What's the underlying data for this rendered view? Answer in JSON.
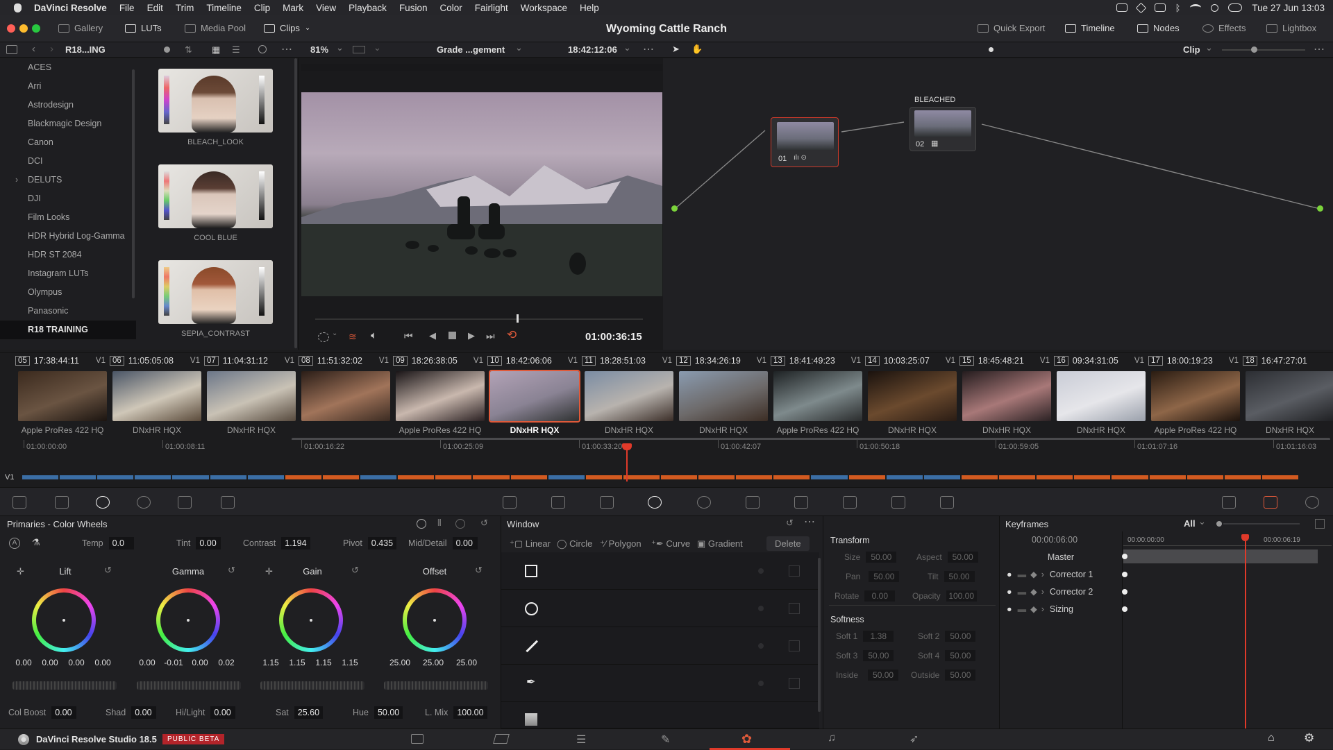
{
  "menubar": {
    "apple": "",
    "app_name": "DaVinci Resolve",
    "items": [
      "File",
      "Edit",
      "Trim",
      "Timeline",
      "Clip",
      "Mark",
      "View",
      "Playback",
      "Fusion",
      "Color",
      "Fairlight",
      "Workspace",
      "Help"
    ],
    "datetime": "Tue 27 Jun  13:03"
  },
  "titlebar": {
    "gallery": "Gallery",
    "luts": "LUTs",
    "media_pool": "Media Pool",
    "clips": "Clips",
    "project_title": "Wyoming Cattle Ranch",
    "quick_export": "Quick Export",
    "timeline": "Timeline",
    "nodes": "Nodes",
    "effects": "Effects",
    "lightbox": "Lightbox"
  },
  "toolbar2": {
    "folder": "R18...ING",
    "zoom": "81%",
    "grade_name": "Grade ...gement",
    "timecode": "18:42:12:06",
    "clip_mode": "Clip"
  },
  "lut_folders": [
    "ACES",
    "Arri",
    "Astrodesign",
    "Blackmagic Design",
    "Canon",
    "DCI",
    "DELUTS",
    "DJI",
    "Film Looks",
    "HDR Hybrid Log-Gamma",
    "HDR ST 2084",
    "Instagram LUTs",
    "Olympus",
    "Panasonic",
    "R18 TRAINING"
  ],
  "lut_thumbs": [
    "BLEACH_LOOK",
    "COOL BLUE",
    "SEPIA_CONTRAST"
  ],
  "viewer": {
    "timecode": "01:00:36:15"
  },
  "nodes": {
    "node1_label": "01",
    "node2_title": "BLEACHED",
    "node2_label": "02"
  },
  "clips": [
    {
      "num": "05",
      "tc": "17:38:44:11",
      "track": "V1",
      "codec": "Apple ProRes 422 HQ",
      "colors": [
        "#3b2a1e",
        "#6a5442",
        "#1b1410"
      ]
    },
    {
      "num": "06",
      "tc": "11:05:05:08",
      "track": "V1",
      "codec": "DNxHR HQX",
      "colors": [
        "#4a5566",
        "#cfc7b8",
        "#5a4a3a"
      ]
    },
    {
      "num": "07",
      "tc": "11:04:31:12",
      "track": "V1",
      "codec": "DNxHR HQX",
      "colors": [
        "#6b7688",
        "#c9c2b5",
        "#56493d"
      ]
    },
    {
      "num": "08",
      "tc": "11:51:32:02",
      "track": "V1",
      "codec": "",
      "colors": [
        "#2a1d17",
        "#a1745a",
        "#3b2b22"
      ]
    },
    {
      "num": "09",
      "tc": "18:26:38:05",
      "track": "V1",
      "codec": "Apple ProRes 422 HQ",
      "colors": [
        "#1a1517",
        "#c9b8ae",
        "#2a2022"
      ]
    },
    {
      "num": "10",
      "tc": "18:42:06:06",
      "track": "V1",
      "codec": "DNxHR HQX",
      "colors": [
        "#b2a2b6",
        "#8a8394",
        "#2f3232"
      ]
    },
    {
      "num": "11",
      "tc": "18:28:51:03",
      "track": "V1",
      "codec": "DNxHR HQX",
      "colors": [
        "#7a8ca3",
        "#b8b3ae",
        "#3b2e28"
      ]
    },
    {
      "num": "12",
      "tc": "18:34:26:19",
      "track": "V1",
      "codec": "DNxHR HQX",
      "colors": [
        "#8a9bb0",
        "#6d6a6a",
        "#3c2d24"
      ]
    },
    {
      "num": "13",
      "tc": "18:41:49:23",
      "track": "V1",
      "codec": "Apple ProRes 422 HQ",
      "colors": [
        "#1e2224",
        "#7e8a8c",
        "#2a2c2d"
      ]
    },
    {
      "num": "14",
      "tc": "10:03:25:07",
      "track": "V1",
      "codec": "DNxHR HQX",
      "colors": [
        "#1a120e",
        "#6b4a2e",
        "#2a1c14"
      ]
    },
    {
      "num": "15",
      "tc": "18:45:48:21",
      "track": "V1",
      "codec": "DNxHR HQX",
      "colors": [
        "#241c1e",
        "#a87878",
        "#2b2224"
      ]
    },
    {
      "num": "16",
      "tc": "09:34:31:05",
      "track": "V1",
      "codec": "DNxHR HQX",
      "colors": [
        "#c9ccd6",
        "#e6e6ea",
        "#9aa0ab"
      ]
    },
    {
      "num": "17",
      "tc": "18:00:19:23",
      "track": "V1",
      "codec": "Apple ProRes 422 HQ",
      "colors": [
        "#2a1c12",
        "#8e6648",
        "#1d130d"
      ]
    },
    {
      "num": "18",
      "tc": "16:47:27:01",
      "track": "",
      "codec": "DNxHR HQX",
      "colors": [
        "#2c2e33",
        "#5a5d63",
        "#1f2023"
      ]
    }
  ],
  "ruler": {
    "ticks": [
      "01:00:00:00",
      "01:00:08:11",
      "01:00:16:22",
      "01:00:25:09",
      "01:00:33:20",
      "01:00:42:07",
      "01:00:50:18",
      "01:00:59:05",
      "01:01:07:16",
      "01:01:16:03"
    ],
    "track_label": "V1"
  },
  "primaries": {
    "title": "Primaries - Color Wheels",
    "temp_label": "Temp",
    "temp": "0.0",
    "tint_label": "Tint",
    "tint": "0.00",
    "contrast_label": "Contrast",
    "contrast": "1.194",
    "pivot_label": "Pivot",
    "pivot": "0.435",
    "middetail_label": "Mid/Detail",
    "middetail": "0.00",
    "wheels": [
      {
        "label": "Lift",
        "values": [
          "0.00",
          "0.00",
          "0.00",
          "0.00"
        ]
      },
      {
        "label": "Gamma",
        "values": [
          "0.00",
          "-0.01",
          "0.00",
          "0.02"
        ]
      },
      {
        "label": "Gain",
        "values": [
          "1.15",
          "1.15",
          "1.15",
          "1.15"
        ]
      },
      {
        "label": "Offset",
        "values": [
          "25.00",
          "25.00",
          "25.00"
        ]
      }
    ],
    "colboost_label": "Col Boost",
    "colboost": "0.00",
    "shad_label": "Shad",
    "shad": "0.00",
    "hilight_label": "Hi/Light",
    "hilight": "0.00",
    "sat_label": "Sat",
    "sat": "25.60",
    "hue_label": "Hue",
    "hue": "50.00",
    "lmix_label": "L. Mix",
    "lmix": "100.00"
  },
  "window": {
    "title": "Window",
    "linear": "Linear",
    "circle": "Circle",
    "polygon": "Polygon",
    "curve": "Curve",
    "gradient": "Gradient",
    "delete": "Delete"
  },
  "transform": {
    "title": "Transform",
    "size_label": "Size",
    "size": "50.00",
    "aspect_label": "Aspect",
    "aspect": "50.00",
    "pan_label": "Pan",
    "pan": "50.00",
    "tilt_label": "Tilt",
    "tilt": "50.00",
    "rotate_label": "Rotate",
    "rotate": "0.00",
    "opacity_label": "Opacity",
    "opacity": "100.00",
    "softness_title": "Softness",
    "soft1_label": "Soft 1",
    "soft1": "1.38",
    "soft2_label": "Soft 2",
    "soft2": "50.00",
    "soft3_label": "Soft 3",
    "soft3": "50.00",
    "soft4_label": "Soft 4",
    "soft4": "50.00",
    "inside_label": "Inside",
    "inside": "50.00",
    "outside_label": "Outside",
    "outside": "50.00"
  },
  "keyframes": {
    "title": "Keyframes",
    "filter": "All",
    "current_tc": "00:00:06:00",
    "start_tc": "00:00:00:00",
    "end_tc": "00:00:06:19",
    "rows": [
      "Master",
      "Corrector 1",
      "Corrector 2",
      "Sizing"
    ]
  },
  "bottombar": {
    "app_name": "DaVinci Resolve Studio 18.5",
    "badge": "PUBLIC BETA"
  }
}
